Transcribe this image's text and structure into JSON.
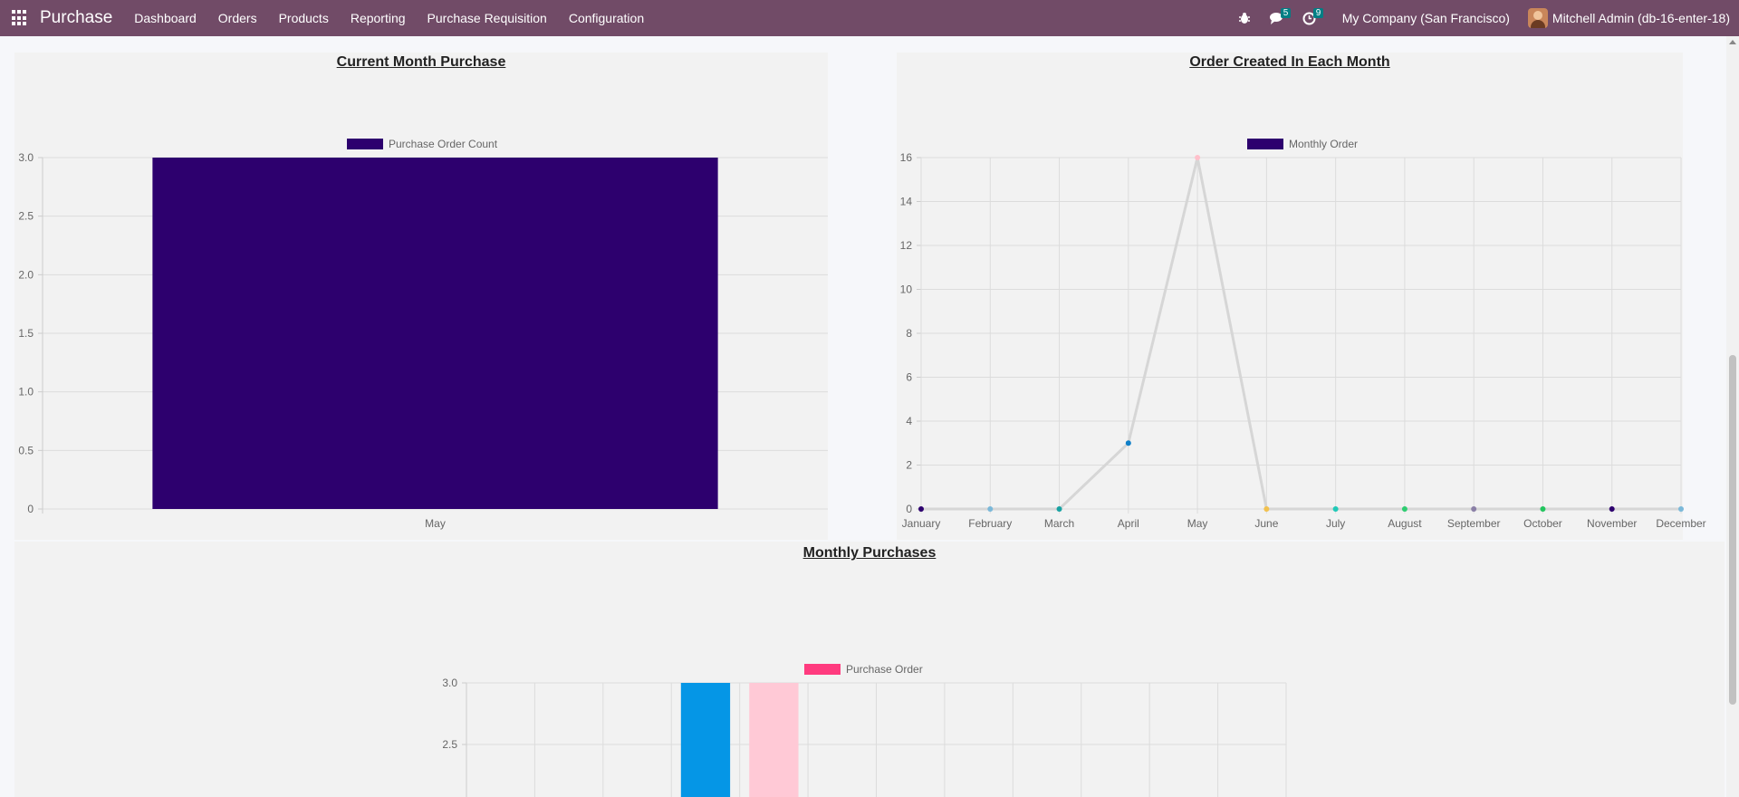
{
  "navbar": {
    "brand": "Purchase",
    "menu": [
      "Dashboard",
      "Orders",
      "Products",
      "Reporting",
      "Purchase Requisition",
      "Configuration"
    ],
    "messages_count": "5",
    "activities_count": "9",
    "company": "My Company (San Francisco)",
    "user": "Mitchell Admin (db-16-enter-18)"
  },
  "colors": {
    "navbar": "#714b67",
    "bar_purple": "#2d006e",
    "legend_pink": "#ff3b7f",
    "bar_blue": "#0596e6",
    "bar_pink": "#ffc9d6"
  },
  "panels": {
    "current_month": {
      "title": "Current Month Purchase"
    },
    "order_created": {
      "title": "Order Created In Each Month"
    },
    "monthly": {
      "title": "Monthly Purchases"
    }
  },
  "chart_data": [
    {
      "type": "bar",
      "title": "Current Month Purchase",
      "categories": [
        "May"
      ],
      "series": [
        {
          "name": "Purchase Order Count",
          "values": [
            3
          ]
        }
      ],
      "ylim": [
        0,
        3
      ],
      "yticks": [
        "0",
        "0.5",
        "1.0",
        "1.5",
        "2.0",
        "2.5",
        "3.0"
      ],
      "grid": true,
      "legend": "top-center"
    },
    {
      "type": "line",
      "title": "Order Created In Each Month",
      "categories": [
        "January",
        "February",
        "March",
        "April",
        "May",
        "June",
        "July",
        "August",
        "September",
        "October",
        "November",
        "December"
      ],
      "series": [
        {
          "name": "Monthly Order",
          "values": [
            0,
            0,
            0,
            3,
            16,
            0,
            0,
            0,
            0,
            0,
            0,
            0
          ]
        }
      ],
      "point_colors": [
        "#2d006e",
        "#7ab8d9",
        "#17a2a2",
        "#0f7fc8",
        "#ffc0cb",
        "#f2c14e",
        "#20c9b8",
        "#2ecc71",
        "#8a7fa6",
        "#22c55e",
        "#2d006e",
        "#7ab8d9"
      ],
      "ylim": [
        0,
        16
      ],
      "yticks": [
        "0",
        "2",
        "4",
        "6",
        "8",
        "10",
        "12",
        "14",
        "16"
      ],
      "grid": true,
      "legend": "top-center"
    },
    {
      "type": "bar",
      "title": "Monthly Purchases",
      "categories": [
        "",
        "",
        "",
        "",
        "",
        "",
        "",
        "",
        "",
        "",
        "",
        ""
      ],
      "series": [
        {
          "name": "Purchase Order",
          "values": [
            null,
            null,
            null,
            3,
            3,
            null,
            null,
            null,
            null,
            null,
            null,
            null
          ]
        }
      ],
      "bar_colors": [
        "#0596e6",
        "#0596e6",
        "#0596e6",
        "#0596e6",
        "#ffc9d6",
        "#0596e6",
        "#0596e6",
        "#0596e6",
        "#0596e6",
        "#0596e6",
        "#0596e6",
        "#0596e6"
      ],
      "ylim": [
        0,
        3
      ],
      "yticks_visible": [
        "3.0",
        "2.5"
      ],
      "grid": true,
      "legend": "top-center"
    }
  ]
}
